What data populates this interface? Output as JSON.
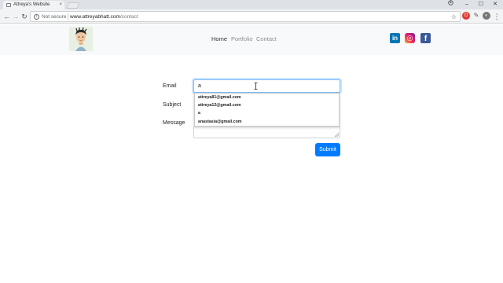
{
  "browser": {
    "tab_title": "Attreya's Website",
    "tab_close": "×",
    "back": "←",
    "forward": "→",
    "reload": "↻",
    "security": "Not secure",
    "url_host": "www.attreyabhatt.com",
    "url_path": "/contact",
    "star": "☆",
    "minimize": "–",
    "maximize": "☐",
    "close": "✕",
    "menu": "⋮"
  },
  "nav": {
    "links": [
      {
        "label": "Home",
        "active": true
      },
      {
        "label": "Portfolio",
        "active": false
      },
      {
        "label": "Contact",
        "active": false
      }
    ]
  },
  "social": {
    "linkedin": "in",
    "instagram": "◎",
    "facebook": "f"
  },
  "form": {
    "email_label": "Email",
    "subject_label": "Subject",
    "message_label": "Message",
    "email_value": "a",
    "submit_label": "Submit"
  },
  "autocomplete": {
    "items": [
      "attreya81@gmail.com",
      "attreya12@gmail.com",
      "a",
      "anastasia@gmail.com"
    ]
  },
  "colors": {
    "primary": "#007bff",
    "linkedin": "#0077b5",
    "facebook": "#3b5998",
    "header_bg": "#f8f9fa"
  }
}
